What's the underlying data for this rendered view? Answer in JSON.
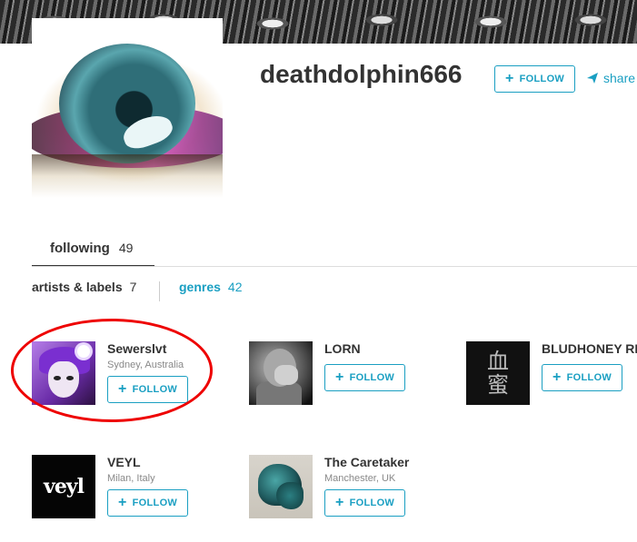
{
  "profile": {
    "username": "deathdolphin666",
    "follow_label": "FOLLOW",
    "share_label": "share"
  },
  "tabs": [
    {
      "label": "following",
      "count": "49",
      "active": true
    }
  ],
  "subtabs": {
    "artists_label": "artists & labels",
    "artists_count": "7",
    "genres_label": "genres",
    "genres_count": "42"
  },
  "artists": [
    {
      "name": "Sewerslvt",
      "location": "Sydney, Australia",
      "follow_label": "FOLLOW",
      "highlighted": true
    },
    {
      "name": "LORN",
      "location": "",
      "follow_label": "FOLLOW"
    },
    {
      "name": "BLUDHONEY RE",
      "location": "",
      "follow_label": "FOLLOW",
      "thumb_text": [
        "血",
        "蜜"
      ]
    },
    {
      "name": "VEYL",
      "location": "Milan, Italy",
      "follow_label": "FOLLOW",
      "thumb_text": "veyl"
    },
    {
      "name": "The Caretaker",
      "location": "Manchester, UK",
      "follow_label": "FOLLOW"
    }
  ],
  "colors": {
    "accent": "#1a9fc2",
    "highlight_ring": "#e00000"
  }
}
